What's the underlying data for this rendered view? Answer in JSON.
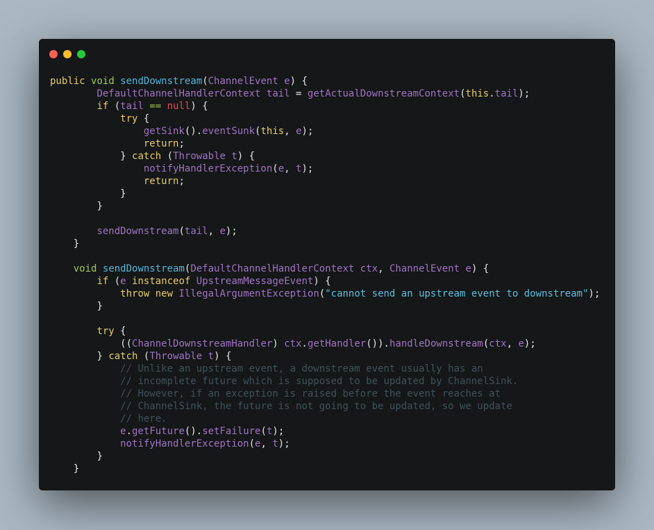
{
  "window": {
    "controls": [
      {
        "name": "close",
        "color": "#ff5f56"
      },
      {
        "name": "minimize",
        "color": "#ffbd2e"
      },
      {
        "name": "maximize",
        "color": "#27c93f"
      }
    ]
  },
  "code": {
    "language": "java",
    "lines": [
      "public void sendDownstream(ChannelEvent e) {",
      "        DefaultChannelHandlerContext tail = getActualDownstreamContext(this.tail);",
      "        if (tail == null) {",
      "            try {",
      "                getSink().eventSunk(this, e);",
      "                return;",
      "            } catch (Throwable t) {",
      "                notifyHandlerException(e, t);",
      "                return;",
      "            }",
      "        }",
      "",
      "        sendDownstream(tail, e);",
      "    }",
      "",
      "    void sendDownstream(DefaultChannelHandlerContext ctx, ChannelEvent e) {",
      "        if (e instanceof UpstreamMessageEvent) {",
      "            throw new IllegalArgumentException(\"cannot send an upstream event to downstream\");",
      "        }",
      "",
      "        try {",
      "            ((ChannelDownstreamHandler) ctx.getHandler()).handleDownstream(ctx, e);",
      "        } catch (Throwable t) {",
      "            // Unlike an upstream event, a downstream event usually has an",
      "            // incomplete future which is supposed to be updated by ChannelSink.",
      "            // However, if an exception is raised before the event reaches at",
      "            // ChannelSink, the future is not going to be updated, so we update",
      "            // here.",
      "            e.getFuture().setFailure(t);",
      "            notifyHandlerException(e, t);",
      "        }",
      "    }"
    ]
  }
}
